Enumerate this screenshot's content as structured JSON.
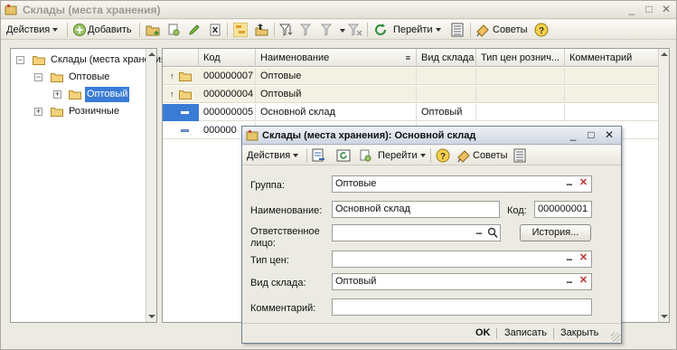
{
  "window": {
    "title": "Склады (места хранения)"
  },
  "toolbar": {
    "actions_label": "Действия",
    "add_label": "Добавить",
    "goto_label": "Перейти",
    "tips_label": "Советы"
  },
  "tree": {
    "items": [
      {
        "label": "Склады (места хранения)",
        "level": 0,
        "expander": "−"
      },
      {
        "label": "Оптовые",
        "level": 1,
        "expander": "−"
      },
      {
        "label": "Оптовый",
        "level": 2,
        "expander": "+"
      },
      {
        "label": "Розничные",
        "level": 1,
        "expander": "+"
      }
    ]
  },
  "list": {
    "columns": [
      "Код",
      "Наименование",
      "Вид склада",
      "Тип цен рознич...",
      "Комментарий"
    ],
    "rows": [
      {
        "code": "000000007",
        "name": "Оптовые",
        "kind": "",
        "price_type": "",
        "comment": "",
        "type": "group"
      },
      {
        "code": "000000004",
        "name": "Оптовый",
        "kind": "",
        "price_type": "",
        "comment": "",
        "type": "group"
      },
      {
        "code": "000000005",
        "name": "Основной склад",
        "kind": "Оптовый",
        "price_type": "",
        "comment": "",
        "type": "item-selected"
      },
      {
        "code": "000000",
        "name": "",
        "kind": "",
        "price_type": "",
        "comment": "",
        "type": "item"
      }
    ]
  },
  "dialog": {
    "title": "Склады (места хранения): Основной склад",
    "toolbar": {
      "actions_label": "Действия",
      "goto_label": "Перейти",
      "tips_label": "Советы"
    },
    "fields": {
      "group_label": "Группа:",
      "group_value": "Оптовые",
      "name_label": "Наименование:",
      "name_value": "Основной склад",
      "code_label": "Код:",
      "code_value": "000000001",
      "responsible_label_1": "Ответственное",
      "responsible_label_2": "лицо:",
      "responsible_value": "",
      "history_label": "История...",
      "price_type_label": "Тип цен:",
      "price_type_value": "",
      "kind_label": "Вид склада:",
      "kind_value": "Оптовый",
      "comment_label": "Комментарий:",
      "comment_value": ""
    },
    "footer": {
      "ok_label": "OK",
      "save_label": "Записать",
      "close_label": "Закрыть"
    }
  }
}
